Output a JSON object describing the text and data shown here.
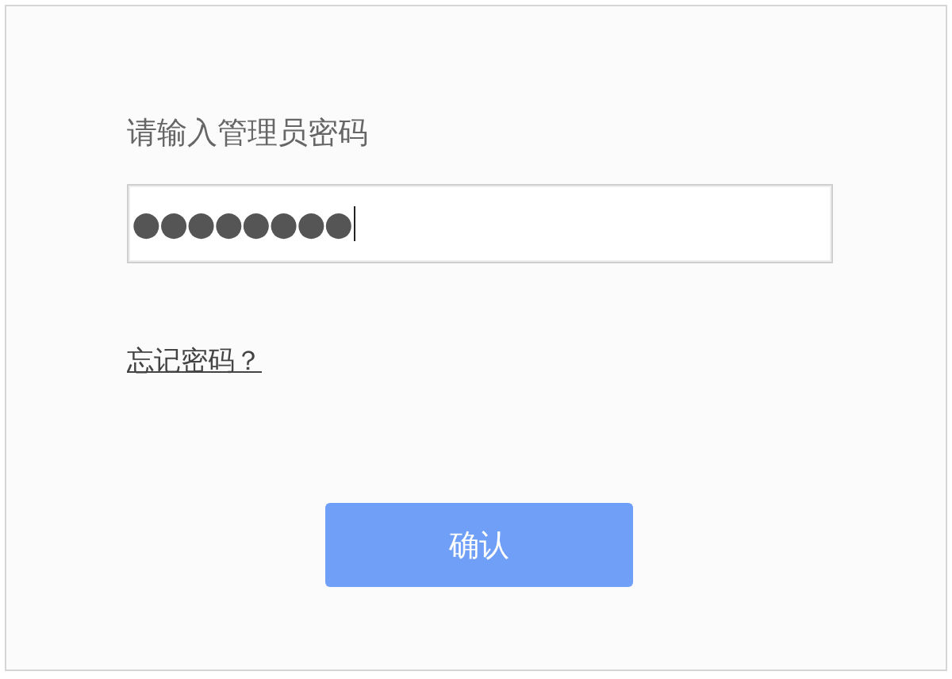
{
  "login_form": {
    "label": "请输入管理员密码",
    "password_field": {
      "value": "●●●●●●●●",
      "focused": true
    },
    "forgot_link": "忘记密码？",
    "confirm_button": "确认"
  }
}
